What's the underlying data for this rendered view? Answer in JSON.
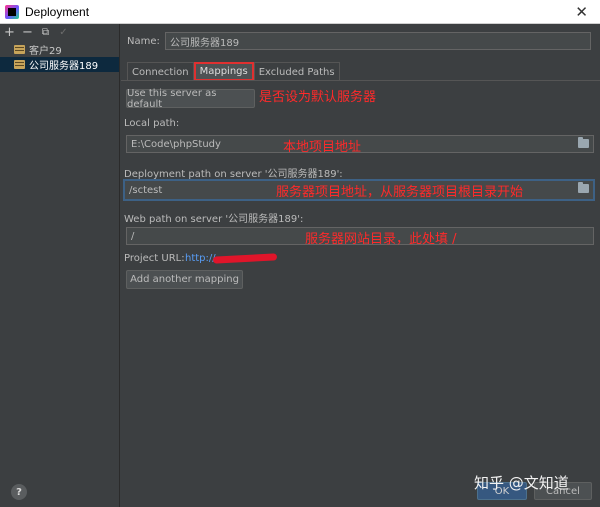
{
  "window": {
    "title": "Deployment",
    "close_glyph": "✕"
  },
  "toolbar": {
    "add": "+",
    "remove": "−",
    "copy": "⧉",
    "check": "✓"
  },
  "servers": [
    {
      "name": "客户29"
    },
    {
      "name": "公司服务器189"
    }
  ],
  "form": {
    "name_label": "Name:",
    "name_value": "公司服务器189",
    "tabs": [
      {
        "label": "Connection"
      },
      {
        "label": "Mappings"
      },
      {
        "label": "Excluded Paths"
      }
    ],
    "default_button": "Use this server as default",
    "local_path_label": "Local path:",
    "local_path_value": "E:\\Code\\phpStudy",
    "deploy_path_label": "Deployment path on server '公司服务器189':",
    "deploy_path_value": "/sctest",
    "web_path_label": "Web path on server '公司服务器189':",
    "web_path_value": "/",
    "project_url_label": "Project URL:",
    "project_url_value": "http://",
    "add_mapping_button": "Add another mapping"
  },
  "annotations": {
    "default_note": "是否设为默认服务器",
    "local_note": "本地项目地址",
    "deploy_note": "服务器项目地址，从服务器项目根目录开始",
    "web_note": "服务器网站目录，此处填 /"
  },
  "footer": {
    "help": "?",
    "ok": "OK",
    "cancel": "Cancel",
    "watermark": "知乎 @文知道"
  },
  "colors": {
    "annotation_red": "#ff2a2a",
    "selection_blue": "#0d293e",
    "link_blue": "#589df6"
  }
}
